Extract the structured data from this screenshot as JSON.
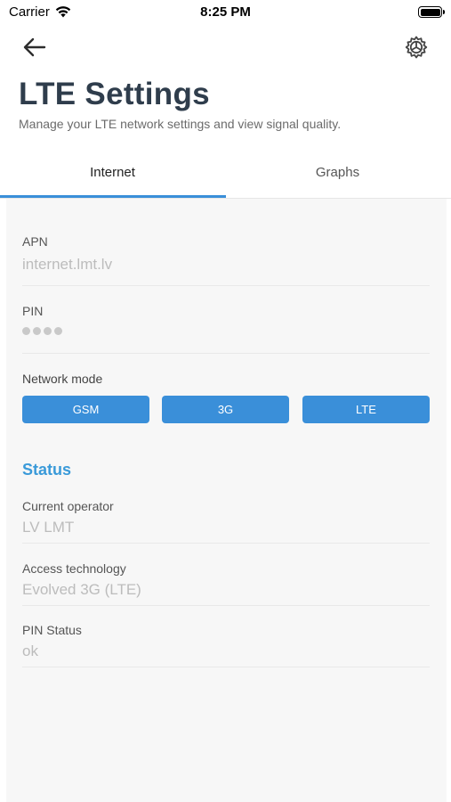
{
  "status_bar": {
    "carrier": "Carrier",
    "time": "8:25 PM"
  },
  "header": {
    "back_icon": "arrow-left-icon",
    "settings_icon": "gear-icon",
    "title": "LTE Settings",
    "subtitle": "Manage your LTE network settings and view signal quality."
  },
  "tabs": [
    {
      "label": "Internet",
      "active": true
    },
    {
      "label": "Graphs",
      "active": false
    }
  ],
  "internet": {
    "apn": {
      "label": "APN",
      "value": "internet.lmt.lv"
    },
    "pin": {
      "label": "PIN",
      "masked_length": 4
    },
    "network_mode": {
      "label": "Network mode",
      "options": [
        "GSM",
        "3G",
        "LTE"
      ]
    }
  },
  "status": {
    "heading": "Status",
    "current_operator": {
      "label": "Current operator",
      "value": "LV LMT"
    },
    "access_technology": {
      "label": "Access technology",
      "value": "Evolved 3G (LTE)"
    },
    "pin_status": {
      "label": "PIN Status",
      "value": "ok"
    }
  },
  "colors": {
    "accent": "#3a8fd9",
    "title": "#2f3d4c",
    "status_heading": "#3a9ad9"
  }
}
